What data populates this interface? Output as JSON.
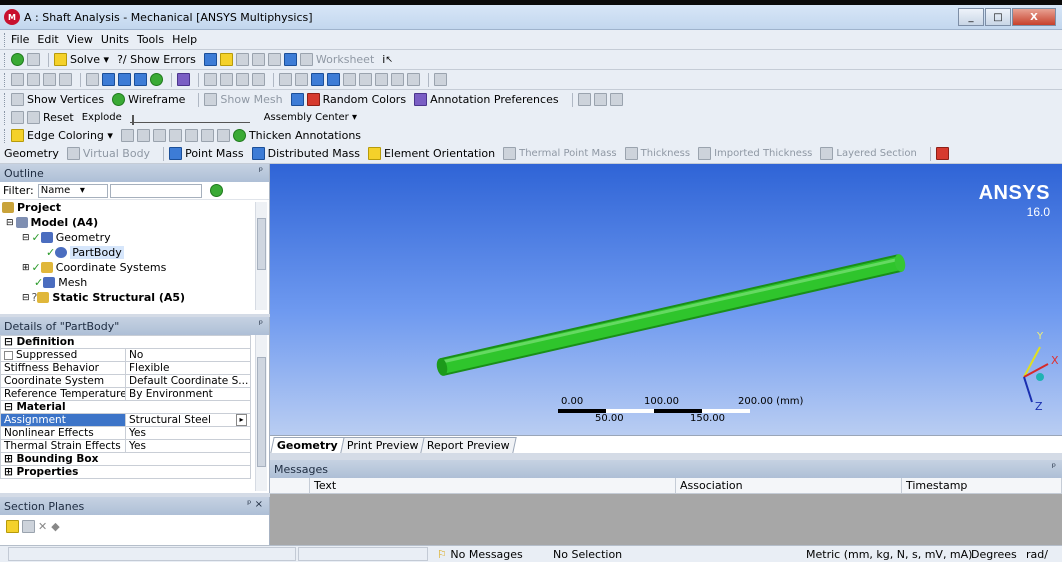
{
  "window": {
    "title": "A : Shaft Analysis - Mechanical [ANSYS Multiphysics]",
    "minimize": "_",
    "maximize": "□",
    "close": "X"
  },
  "menu": [
    "File",
    "Edit",
    "View",
    "Units",
    "Tools",
    "Help"
  ],
  "toolbar1": {
    "solve": "Solve",
    "show_errors": "Show Errors",
    "worksheet": "Worksheet"
  },
  "toolbar3": {
    "show_vertices": "Show Vertices",
    "wireframe": "Wireframe",
    "show_mesh": "Show Mesh",
    "random_colors": "Random Colors",
    "annotation_preferences": "Annotation Preferences"
  },
  "toolbar4": {
    "reset": "Reset",
    "explode": "Explode",
    "assembly_center": "Assembly Center"
  },
  "toolbar5": {
    "edge_coloring": "Edge Coloring",
    "thicken_annotations": "Thicken Annotations"
  },
  "toolbar6": {
    "geometry": "Geometry",
    "virtual_body": "Virtual Body",
    "point_mass": "Point Mass",
    "distributed_mass": "Distributed Mass",
    "element_orientation": "Element Orientation",
    "thermal_point_mass": "Thermal Point Mass",
    "thickness": "Thickness",
    "imported_thickness": "Imported Thickness",
    "layered_section": "Layered Section"
  },
  "outline": {
    "header": "Outline",
    "filter_label": "Filter:",
    "filter_value": "Name",
    "tree": [
      {
        "label": "Project",
        "bold": true
      },
      {
        "label": "Model (A4)",
        "bold": true
      },
      {
        "label": "Geometry",
        "bold": false
      },
      {
        "label": "PartBody",
        "bold": false
      },
      {
        "label": "Coordinate Systems",
        "bold": false
      },
      {
        "label": "Mesh",
        "bold": false
      },
      {
        "label": "Static Structural (A5)",
        "bold": true
      }
    ]
  },
  "details": {
    "header": "Details of \"PartBody\"",
    "groups": {
      "definition": "Definition",
      "material": "Material",
      "bounding_box": "Bounding Box",
      "properties": "Properties"
    },
    "rows": {
      "suppressed": {
        "key": "Suppressed",
        "value": "No"
      },
      "stiffness": {
        "key": "Stiffness Behavior",
        "value": "Flexible"
      },
      "coord": {
        "key": "Coordinate System",
        "value": "Default Coordinate S..."
      },
      "reftemp": {
        "key": "Reference Temperature",
        "value": "By Environment"
      },
      "assignment": {
        "key": "Assignment",
        "value": "Structural Steel"
      },
      "nonlinear": {
        "key": "Nonlinear Effects",
        "value": "Yes"
      },
      "thermal": {
        "key": "Thermal Strain Effects",
        "value": "Yes"
      }
    }
  },
  "section_planes": {
    "header": "Section Planes"
  },
  "viewport": {
    "brand": "ANSYS",
    "version": "16.0",
    "scale": {
      "top_labels": [
        "0.00",
        "100.00",
        "200.00 (mm)"
      ],
      "bottom_labels": [
        "50.00",
        "150.00"
      ]
    },
    "triad": {
      "y": "Y",
      "x": "X",
      "z": "Z"
    },
    "body_color": "#2fc52c"
  },
  "view_tabs": [
    "Geometry",
    "Print Preview",
    "Report Preview"
  ],
  "messages": {
    "header": "Messages",
    "columns": [
      "Text",
      "Association",
      "Timestamp"
    ]
  },
  "status": {
    "no_messages": "No Messages",
    "no_selection": "No Selection",
    "units": "Metric (mm, kg, N, s, mV, mA)",
    "degrees": "Degrees",
    "rad": "rad/"
  }
}
